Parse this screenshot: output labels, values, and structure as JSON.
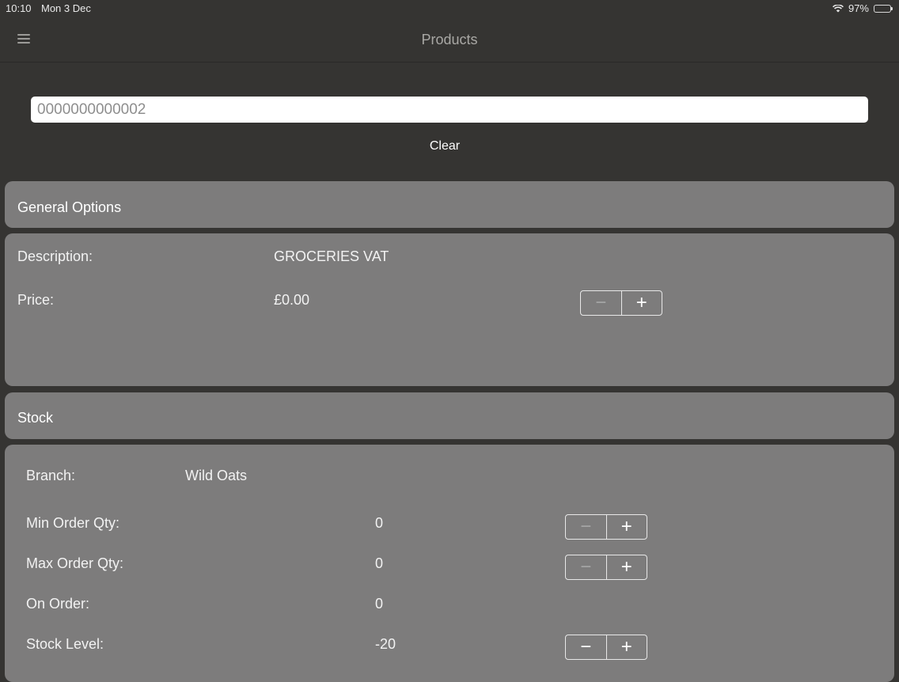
{
  "status_bar": {
    "time": "10:10",
    "date": "Mon 3 Dec",
    "battery": "97%"
  },
  "nav": {
    "title": "Products"
  },
  "search": {
    "value": "0000000000002"
  },
  "clear_label": "Clear",
  "general": {
    "header": "General Options",
    "description_label": "Description:",
    "description_value": "GROCERIES VAT",
    "price_label": "Price:",
    "price_value": "£0.00"
  },
  "stock": {
    "header": "Stock",
    "branch_label": "Branch:",
    "branch_value": "Wild Oats",
    "min_label": "Min Order Qty:",
    "min_value": "0",
    "max_label": "Max Order Qty:",
    "max_value": "0",
    "on_order_label": "On Order:",
    "on_order_value": "0",
    "level_label": "Stock Level:",
    "level_value": "-20"
  },
  "stepper": {
    "minus": "−",
    "plus": "+"
  }
}
